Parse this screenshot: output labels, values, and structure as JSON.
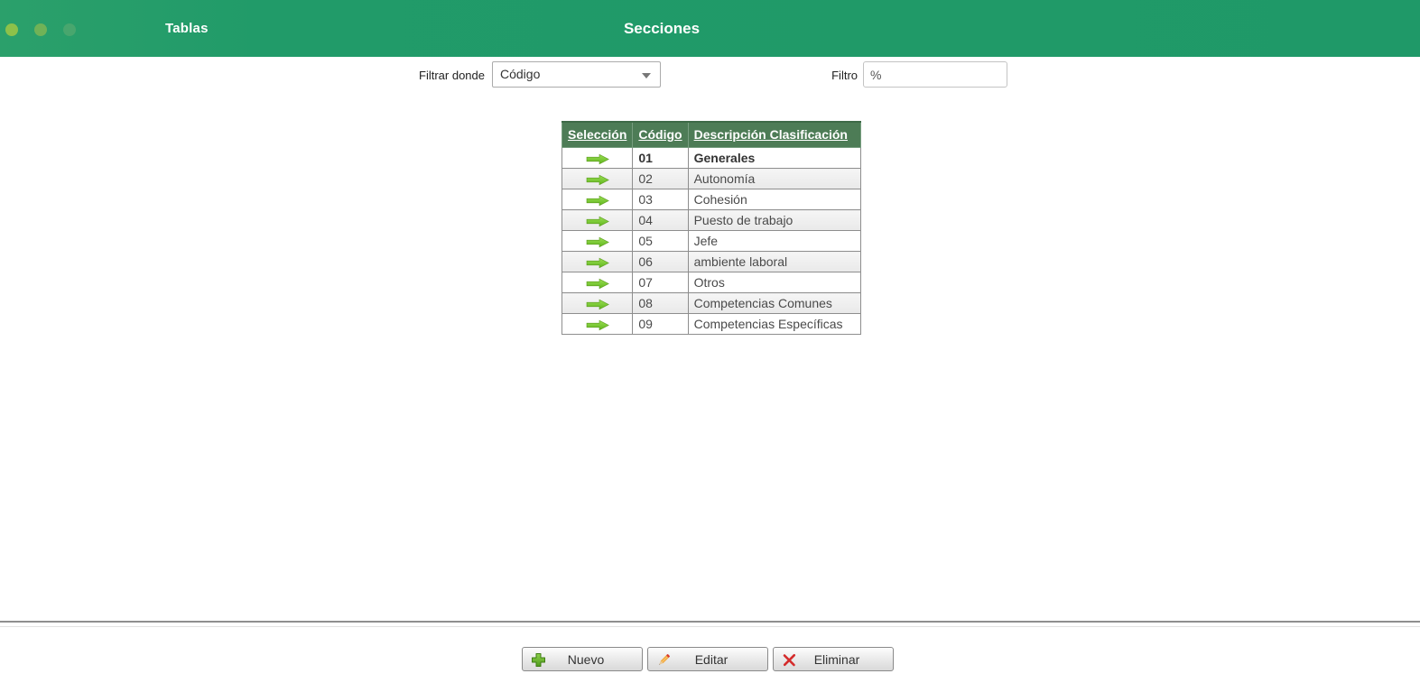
{
  "header": {
    "app_title": "Tablas",
    "page_title": "Secciones"
  },
  "filter": {
    "where_label": "Filtrar donde",
    "where_value": "Código",
    "filtro_label": "Filtro",
    "filtro_value": "%"
  },
  "table": {
    "columns": [
      "Selección",
      "Código",
      "Descripción Clasificación"
    ],
    "rows": [
      {
        "codigo": "01",
        "descripcion": "Generales",
        "selected": true
      },
      {
        "codigo": "02",
        "descripcion": "Autonomía",
        "selected": false
      },
      {
        "codigo": "03",
        "descripcion": "Cohesión",
        "selected": false
      },
      {
        "codigo": "04",
        "descripcion": "Puesto de trabajo",
        "selected": false
      },
      {
        "codigo": "05",
        "descripcion": "Jefe",
        "selected": false
      },
      {
        "codigo": "06",
        "descripcion": "ambiente laboral",
        "selected": false
      },
      {
        "codigo": "07",
        "descripcion": "Otros",
        "selected": false
      },
      {
        "codigo": "08",
        "descripcion": "Competencias Comunes",
        "selected": false
      },
      {
        "codigo": "09",
        "descripcion": "Competencias Específicas",
        "selected": false
      }
    ]
  },
  "toolbar": {
    "buttons": [
      {
        "label": "Nuevo",
        "icon": "plus-icon"
      },
      {
        "label": "Editar",
        "icon": "pencil-icon"
      },
      {
        "label": "Eliminar",
        "icon": "x-icon"
      }
    ]
  },
  "colors": {
    "header_green": "#1f9968",
    "table_header_green": "#4d7c56",
    "arrow_green": "#72c02c",
    "delete_red": "#d42b2b",
    "pencil_orange": "#f0a53c"
  }
}
